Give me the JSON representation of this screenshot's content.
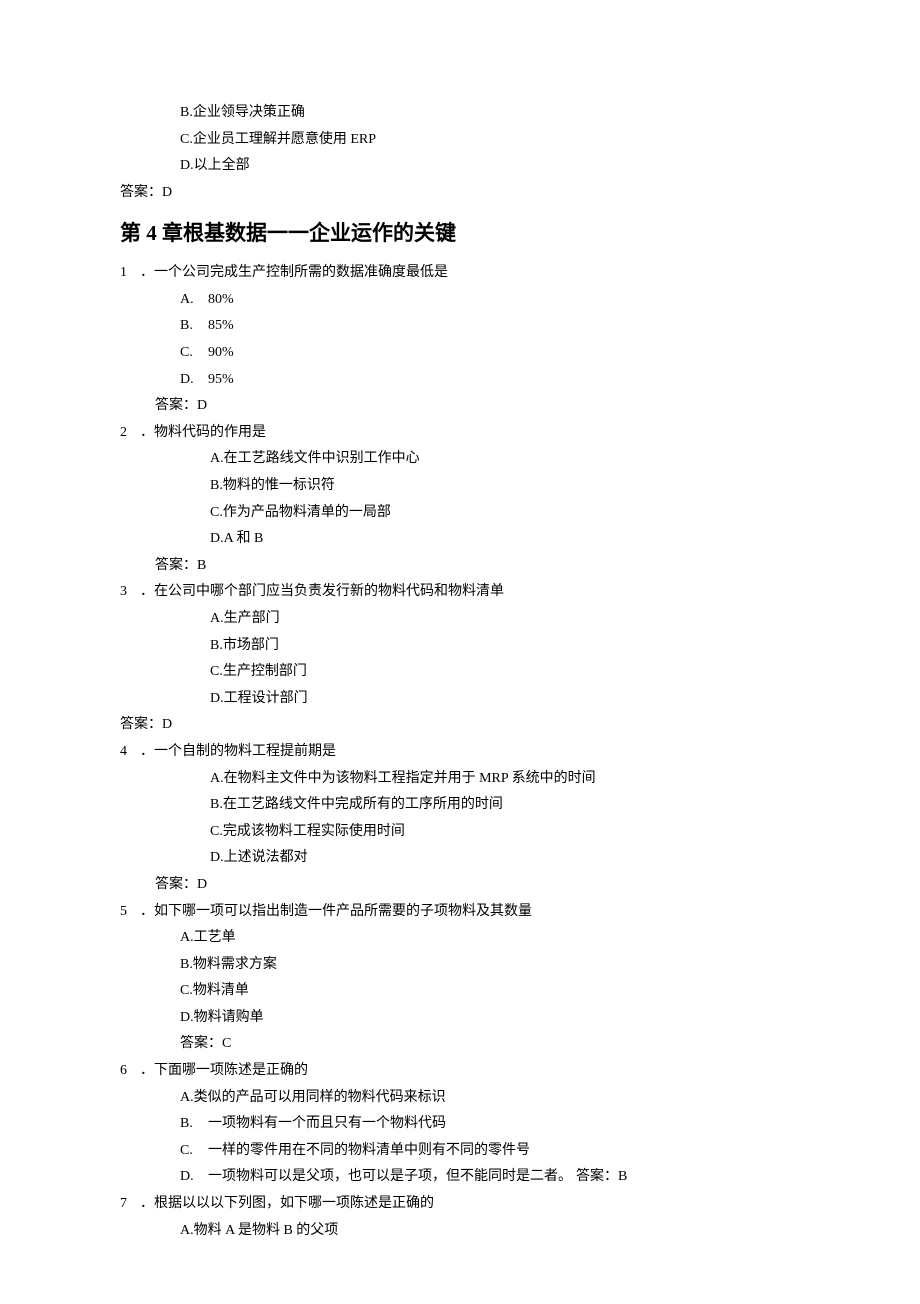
{
  "pre_options": {
    "b": "B.企业领导决策正确",
    "c": "C.企业员工理解并愿意使用 ERP",
    "d": "D.以上全部"
  },
  "pre_answer": "答案：D",
  "chapter_title": "第 4 章根基数据一一企业运作的关键",
  "q1": {
    "num": "1",
    "text": "．一个公司完成生产控制所需的数据准确度最低是",
    "opts": {
      "a_l": "A.",
      "a_t": "80%",
      "b_l": "B.",
      "b_t": "85%",
      "c_l": "C.",
      "c_t": "90%",
      "d_l": "D.",
      "d_t": "95%"
    },
    "answer": "答案：D"
  },
  "q2": {
    "num": "2",
    "text": "．物料代码的作用是",
    "opts": {
      "a": "A.在工艺路线文件中识别工作中心",
      "b": "B.物料的惟一标识符",
      "c": "C.作为产品物料清单的一局部",
      "d": "D.A 和 B"
    },
    "answer": "答案：B"
  },
  "q3": {
    "num": "3",
    "text": "．在公司中哪个部门应当负责发行新的物料代码和物料清单",
    "opts": {
      "a": "A.生产部门",
      "b": "B.市场部门",
      "c": "C.生产控制部门",
      "d": "D.工程设计部门"
    },
    "answer": "答案：D"
  },
  "q4": {
    "num": "4",
    "text": "．一个自制的物料工程提前期是",
    "opts": {
      "a": "A.在物料主文件中为该物料工程指定并用于 MRP 系统中的时间",
      "b": "B.在工艺路线文件中完成所有的工序所用的时间",
      "c": "C.完成该物料工程实际使用时间",
      "d": "D.上述说法都对"
    },
    "answer": "答案：D"
  },
  "q5": {
    "num": "5",
    "text": "．如下哪一项可以指出制造一件产品所需要的子项物料及其数量",
    "opts": {
      "a": "A.工艺单",
      "b": "B.物料需求方案",
      "c": "C.物料清单",
      "d": "D.物料请购单"
    },
    "answer": "答案：C"
  },
  "q6": {
    "num": "6",
    "text": "．下面哪一项陈述是正确的",
    "opts": {
      "a": "A.类似的产品可以用同样的物料代码来标识",
      "b_l": "B.",
      "b_t": "一项物料有一个而且只有一个物料代码",
      "c_l": "C.",
      "c_t": "一样的零件用在不同的物料清单中则有不同的零件号",
      "d_l": "D.",
      "d_t": "一项物料可以是父项，也可以是子项，但不能同时是二者。"
    },
    "inline_answer": "答案：B"
  },
  "q7": {
    "num": "7",
    "text": "．根据以以以下列图，如下哪一项陈述是正确的",
    "opts": {
      "a": "A.物料 A 是物料 B 的父项"
    }
  }
}
